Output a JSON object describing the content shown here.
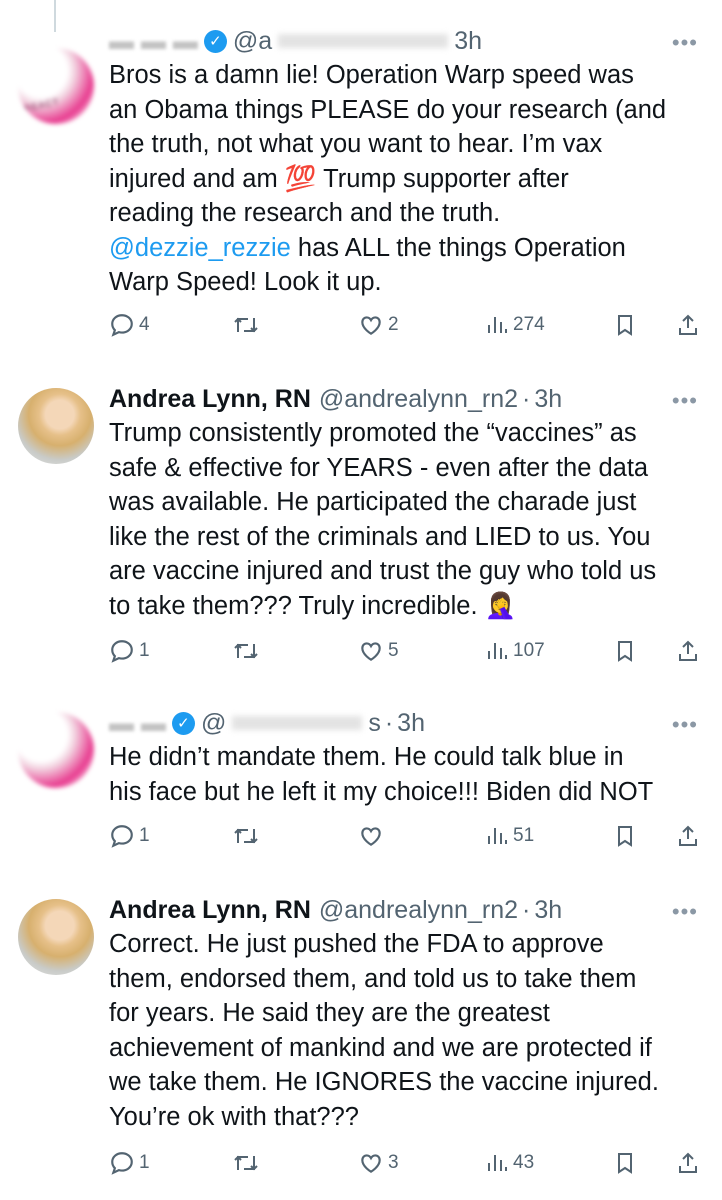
{
  "tweets": [
    {
      "name": "",
      "handle": "@a",
      "time": "3h",
      "text_lines": [
        "Bros is a damn lie! Operation Warp speed was",
        "an Obama  things PLEASE do your research (and",
        "the truth, not what you want to hear. I’m vax",
        "injured and am 💯 Trump supporter after",
        "reading the research and the truth.",
        "@dezzie_rezzie has ALL the things Operation",
        "Warp Speed! Look it up."
      ],
      "mention": "@dezzie_rezzie",
      "replies": "4",
      "retweets": "",
      "likes": "2",
      "views": "274"
    },
    {
      "name": "Andrea Lynn, RN",
      "handle": "@andrealynn_rn2",
      "dot": "·",
      "time": "3h",
      "text_lines": [
        "Trump consistently promoted the “vaccines” as",
        "safe & effective for YEARS - even after the data",
        "was available. He participated the charade just",
        "like the rest of the criminals and LIED to us. You",
        "are vaccine injured and trust the guy who told us",
        "to take them??? Truly incredible. 🤦‍♀️"
      ],
      "replies": "1",
      "retweets": "",
      "likes": "5",
      "views": "107"
    },
    {
      "name": "",
      "handle": "@",
      "handle_tail": "s",
      "dot": "·",
      "time": "3h",
      "text_lines": [
        "He didn’t mandate them. He could talk blue in",
        "his face but he left it my choice!!! Biden did NOT"
      ],
      "replies": "1",
      "retweets": "",
      "likes": "",
      "views": "51"
    },
    {
      "name": "Andrea Lynn, RN",
      "handle": "@andrealynn_rn2",
      "dot": "·",
      "time": "3h",
      "text_lines": [
        "Correct. He just pushed the FDA to approve",
        "them, endorsed them, and told us to take them",
        "for years. He said they are the greatest",
        "achievement of mankind and we are protected if",
        "we take them. He IGNORES the vaccine injured.",
        "You’re ok with that???"
      ],
      "replies": "1",
      "retweets": "",
      "likes": "3",
      "views": "43"
    }
  ],
  "ui": {
    "more_glyph": "•••",
    "verified_glyph": "✓",
    "avatar1_tag": "REACT",
    "icons": [
      "reply-icon",
      "retweet-icon",
      "like-icon",
      "views-icon",
      "bookmark-icon",
      "share-icon",
      "more-icon",
      "verified-badge-icon"
    ],
    "colors": {
      "text": "#0f1419",
      "secondary": "#536471",
      "link": "#1d9bf0",
      "divider": "#cfd9de"
    }
  }
}
